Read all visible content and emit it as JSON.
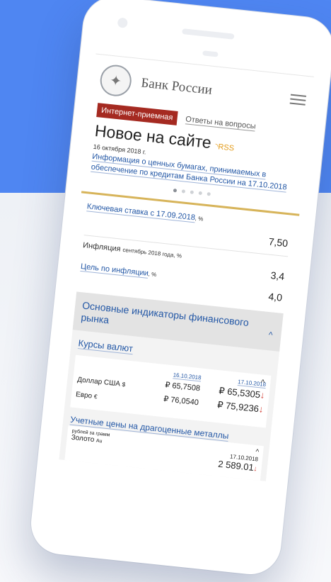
{
  "header": {
    "bank_name": "Банк России",
    "logo_icon": "eagle-emblem-icon",
    "menu_icon": "hamburger-menu-icon"
  },
  "buttons": {
    "reception": "Интернет-приемная",
    "faq": "Ответы на вопросы"
  },
  "news": {
    "title": "Новое на сайте",
    "rss": "RSS",
    "date": "16 октября 2018 г.",
    "link": "Информация о ценных бумагах, принимаемых в обеспечение по кредитам Банка России на 17.10.2018",
    "carousel_count": 5,
    "carousel_active": 1
  },
  "key_rate": {
    "label": "Ключевая ставка с 17.09.2018",
    "unit": ", %",
    "value": "7,50"
  },
  "inflation": {
    "label": "Инфляция",
    "period": "сентябрь 2018 года, %",
    "value": "3,4",
    "goal_label": "Цель по инфляции",
    "goal_unit": ", %",
    "goal_value": "4,0"
  },
  "indicators": {
    "title": "Основные индикаторы финансового рынка",
    "currency_title": "Курсы валют",
    "currencies": [
      {
        "name": "Доллар США",
        "symbol": "$"
      },
      {
        "name": "Евро",
        "symbol": "€"
      }
    ],
    "date1": "16.10.2018",
    "date2": "17.10.2018",
    "usd1": "₽ 65,7508",
    "usd2": "₽ 65,5305",
    "eur1": "₽ 76,0540",
    "eur2": "₽ 75,9236",
    "down_arrow": "↓",
    "metals_title": "Учетные цены на драгоценные металлы",
    "metals_unit": "рублей за грамм",
    "gold_name": "Золото",
    "gold_symbol": "Au",
    "gold_date": "17.10.2018",
    "gold_value": "2 589.01"
  },
  "colors": {
    "background_top": "#4f86f2",
    "accent_red": "#a52a21",
    "link_blue": "#2458a6",
    "gold_line": "#d7b45a",
    "down_red": "#d0382e"
  }
}
